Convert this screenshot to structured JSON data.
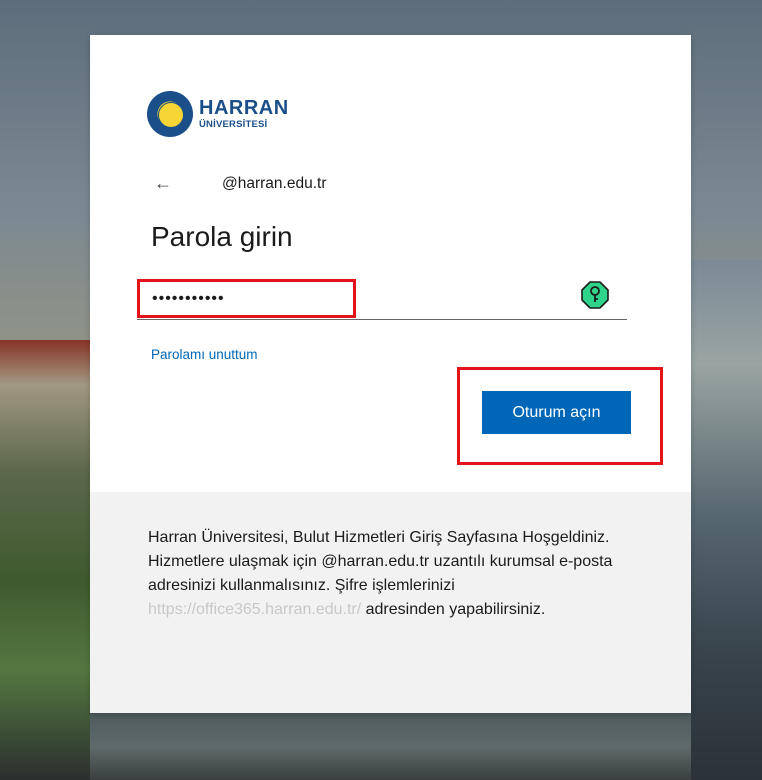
{
  "logo": {
    "title": "HARRAN",
    "subtitle": "ÜNİVERSİTESİ"
  },
  "identity": {
    "email": "@harran.edu.tr"
  },
  "page": {
    "title": "Parola girin"
  },
  "password": {
    "value": "•••••••••••"
  },
  "links": {
    "forgot": "Parolamı unuttum"
  },
  "buttons": {
    "signin": "Oturum açın"
  },
  "footer": {
    "text_before_link": "Harran Üniversitesi, Bulut Hizmetleri Giriş Sayfasına Hoşgeldiniz. Hizmetlere ulaşmak için @harran.edu.tr uzantılı kurumsal e-posta adresinizi kullanmalısınız. Şifre işlemlerinizi ",
    "link": "https://office365.harran.edu.tr/",
    "text_after_link": " adresinden yapabilirsiniz."
  },
  "icons": {
    "back": "arrow-left-icon",
    "key": "key-icon"
  },
  "colors": {
    "accent": "#0067b8",
    "highlight": "#e3131b",
    "key_green": "#2fd38a"
  }
}
